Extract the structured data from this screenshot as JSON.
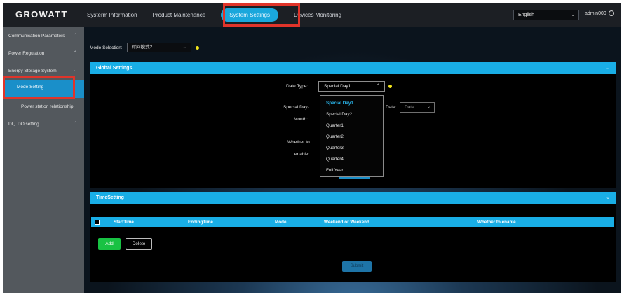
{
  "app": {
    "logo": "GROWATT"
  },
  "nav": {
    "items": [
      {
        "label": "Systerm Information"
      },
      {
        "label": "Product Maintenance"
      },
      {
        "label": "System Settings"
      },
      {
        "label": "Devices Monitoring"
      }
    ],
    "active_index": 2
  },
  "header": {
    "language": "English",
    "user": "admin000"
  },
  "sidebar": {
    "items": [
      {
        "label": "Communication Parameters"
      },
      {
        "label": "Power Regulation"
      },
      {
        "label": "Energy Storage System"
      },
      {
        "label": "Mode Setting"
      },
      {
        "label": "Power station relationship"
      },
      {
        "label": "DI、DO setting"
      }
    ],
    "active_index": 3
  },
  "mode": {
    "label": "Mode Selection:",
    "value": "时间模式2"
  },
  "global_settings": {
    "title": "Global Settings",
    "date_type_label": "Date Type:",
    "date_type_value": "Special Day1",
    "special_day_label": "Special Day-",
    "month_label": "Month:",
    "date_label": "Date:",
    "date_placeholder": "Date",
    "enable_label_1": "Whether to",
    "enable_label_2": "enable:",
    "dropdown_options": [
      "Special Day1",
      "Special Day2",
      "Quarter1",
      "Quarter2",
      "Quarter3",
      "Quarter4",
      "Full Year"
    ]
  },
  "time_setting": {
    "title": "TimeSetting",
    "columns": [
      "StartTime",
      "EndingTime",
      "Mode",
      "Weekend or Weekend",
      "Whether to enable"
    ],
    "add_label": "Add",
    "delete_label": "Delete",
    "submit_label": "Submit"
  },
  "colors": {
    "accent": "#19aee6",
    "highlight": "#e0342a",
    "add_button": "#18c243",
    "sidebar_bg": "#53585d",
    "indicator": "#f2e51c"
  }
}
